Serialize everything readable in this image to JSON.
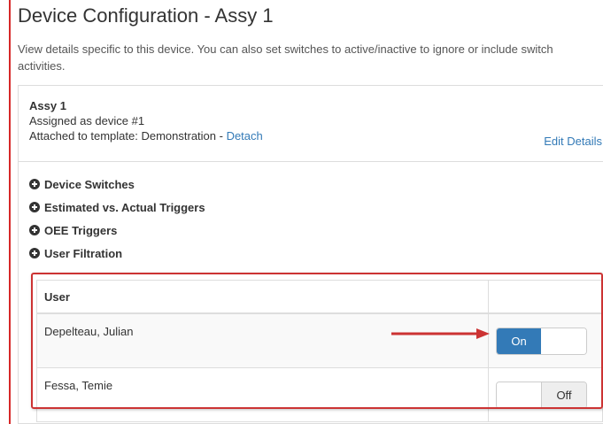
{
  "page": {
    "title": "Device Configuration - Assy 1",
    "description": "View details specific to this device. You can also set switches to active/inactive to ignore or include switch activities."
  },
  "device": {
    "name": "Assy 1",
    "assigned": "Assigned as device #1",
    "template_prefix": "Attached to template: Demonstration - ",
    "detach_link": "Detach",
    "edit_details_link": "Edit Details"
  },
  "sections": [
    {
      "label": "Device Switches",
      "icon": "plus-circle-icon"
    },
    {
      "label": "Estimated vs. Actual Triggers",
      "icon": "plus-circle-icon"
    },
    {
      "label": "OEE Triggers",
      "icon": "plus-circle-icon"
    },
    {
      "label": "User Filtration",
      "icon": "plus-circle-icon"
    }
  ],
  "user_table": {
    "header": "User",
    "rows": [
      {
        "name": "Depelteau, Julian",
        "toggle_state": "On"
      },
      {
        "name": "Fessa, Temie",
        "toggle_state": "Off"
      }
    ]
  },
  "colors": {
    "accent": "#337ab7",
    "annotation_red": "#cc3333",
    "left_bar": "#d62828"
  }
}
